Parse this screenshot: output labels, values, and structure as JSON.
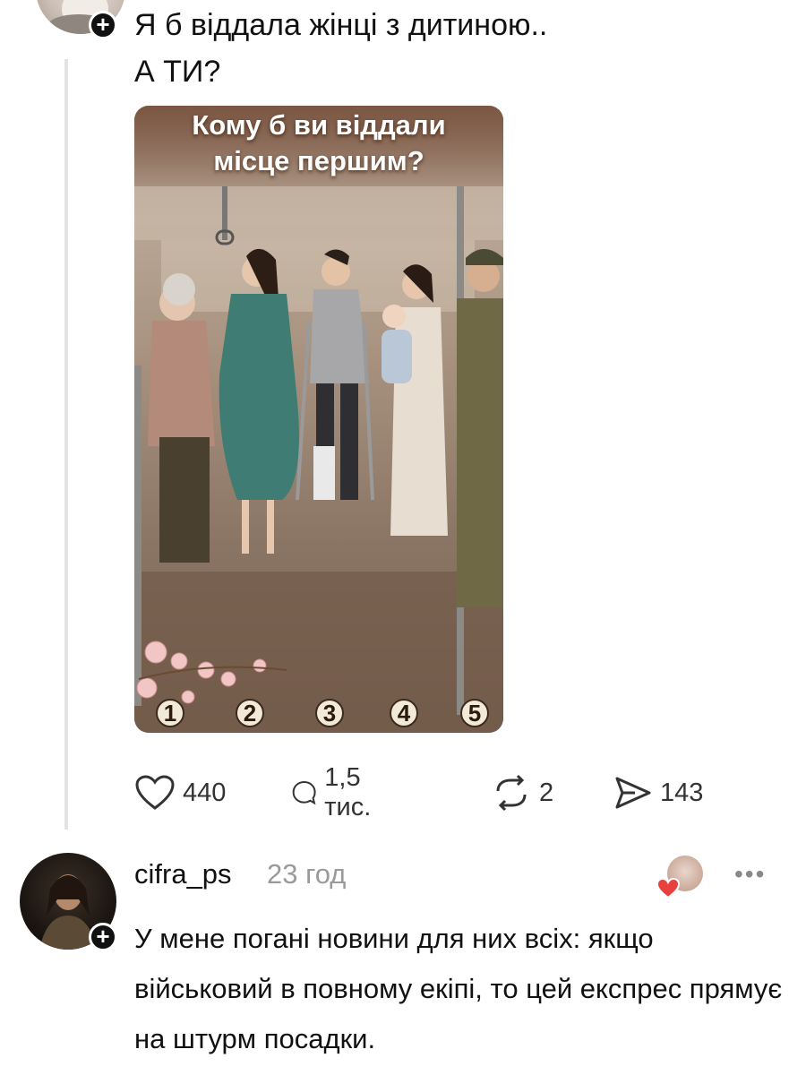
{
  "post": {
    "text_line1": "Я б віддала жінці з дитиною..",
    "text_line2": "А ТИ?",
    "image": {
      "title_line1": "Кому б ви віддали",
      "title_line2": "місце першим?",
      "numbers": [
        "1",
        "2",
        "3",
        "4",
        "5"
      ]
    },
    "actions": {
      "likes": "440",
      "comments": "1,5 тис.",
      "reposts": "2",
      "shares": "143"
    }
  },
  "comment": {
    "username": "cifra_ps",
    "time": "23 год",
    "text": "У мене погані новини для них всіх: якщо військовий в повному екіпі, то цей експрес прямує на штурм посадки.",
    "more_label": "•••"
  },
  "colors": {
    "accent_heart": "#e8413d",
    "text": "#111111",
    "muted": "#9a9a9a"
  },
  "icons": [
    "plus-icon",
    "heart-icon",
    "comment-icon",
    "repost-icon",
    "share-icon",
    "more-icon"
  ]
}
